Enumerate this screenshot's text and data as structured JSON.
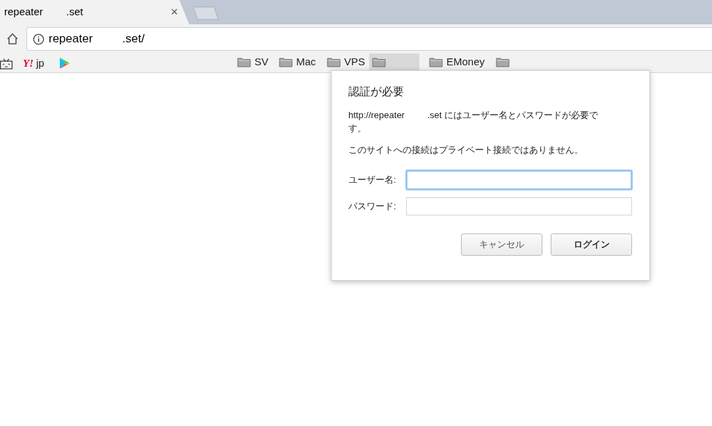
{
  "tab": {
    "title": "repeater        .set",
    "close": "×"
  },
  "address_bar": {
    "url": "repeater         .set/"
  },
  "bookmarks": [
    {
      "kind": "tv",
      "highlighted": false
    },
    {
      "kind": "yahoo",
      "logo_text": "Y!",
      "label": "jp",
      "highlighted": false
    },
    {
      "kind": "play",
      "highlighted": false
    },
    {
      "kind": "folder",
      "label": "SV",
      "highlighted": false
    },
    {
      "kind": "folder",
      "label": "Mac",
      "highlighted": false
    },
    {
      "kind": "folder",
      "label": "VPS",
      "highlighted": false
    },
    {
      "kind": "folder",
      "highlighted": true
    },
    {
      "kind": "folder",
      "label": "EMoney",
      "highlighted": false
    },
    {
      "kind": "folder",
      "highlighted": false
    }
  ],
  "dialog": {
    "title": "認証が必要",
    "message": "http://repeater         .set にはユーザー名とパスワードが必要です。",
    "warning": "このサイトへの接続はプライベート接続ではありません。",
    "fields": [
      {
        "label": "ユーザー名:",
        "focused": true
      },
      {
        "label": "パスワード:",
        "focused": false
      }
    ],
    "buttons": [
      {
        "label": "キャンセル",
        "default": false
      },
      {
        "label": "ログイン",
        "default": true
      }
    ]
  }
}
